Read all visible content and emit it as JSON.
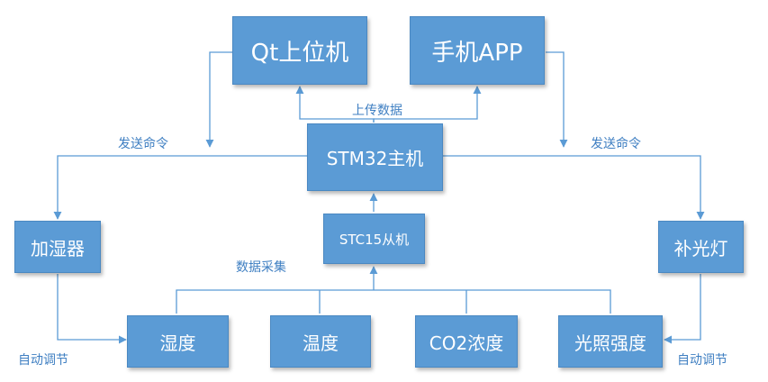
{
  "nodes": {
    "qt": "Qt上位机",
    "app": "手机APP",
    "stm32": "STM32主机",
    "stc15": "STC15从机",
    "humidifier": "加湿器",
    "fill_light": "补光灯",
    "humidity": "湿度",
    "temperature": "温度",
    "co2": "CO2浓度",
    "light": "光照强度"
  },
  "labels": {
    "upload": "上传数据",
    "send_cmd_left": "发送命令",
    "send_cmd_right": "发送命令",
    "collect": "数据采集",
    "auto_left": "自动调节",
    "auto_right": "自动调节"
  },
  "colors": {
    "box_fill": "#5b9bd5",
    "connector": "#5b9bd5",
    "label_text": "#3f7fc2"
  }
}
